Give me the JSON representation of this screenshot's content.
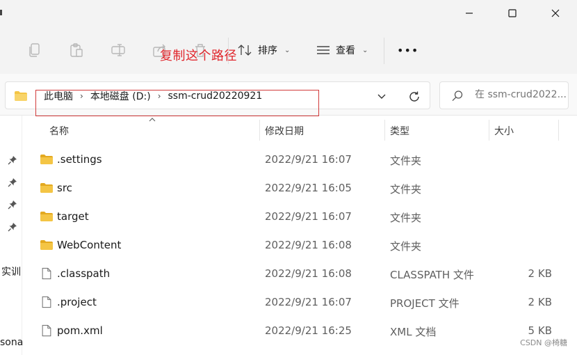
{
  "window": {
    "controls": [
      {
        "name": "minimize-button",
        "icon": "minimize-icon"
      },
      {
        "name": "maximize-button",
        "icon": "maximize-icon"
      },
      {
        "name": "close-button",
        "icon": "close-icon"
      }
    ]
  },
  "toolbar": {
    "icons": [
      "copy-icon",
      "paste-icon",
      "rename-icon",
      "share-icon",
      "delete-icon"
    ],
    "sort_label": "排序",
    "view_label": "查看",
    "more_label": "•••"
  },
  "annotation": {
    "text": "复制这个路径",
    "color": "#e0262c"
  },
  "address": {
    "crumbs": [
      "此电脑",
      "本地磁盘 (D:)",
      "ssm-crud20220921"
    ],
    "separator": "›"
  },
  "search": {
    "placeholder": "在 ssm-crud2022..."
  },
  "nav": {
    "items": [
      "实训",
      "sona"
    ]
  },
  "columns": {
    "name": "名称",
    "modified": "修改日期",
    "type": "类型",
    "size": "大小"
  },
  "files": [
    {
      "name": ".settings",
      "modified": "2022/9/21 16:07",
      "type": "文件夹",
      "size": "",
      "kind": "folder"
    },
    {
      "name": "src",
      "modified": "2022/9/21 16:05",
      "type": "文件夹",
      "size": "",
      "kind": "folder"
    },
    {
      "name": "target",
      "modified": "2022/9/21 16:07",
      "type": "文件夹",
      "size": "",
      "kind": "folder"
    },
    {
      "name": "WebContent",
      "modified": "2022/9/21 16:08",
      "type": "文件夹",
      "size": "",
      "kind": "folder"
    },
    {
      "name": ".classpath",
      "modified": "2022/9/21 16:08",
      "type": "CLASSPATH 文件",
      "size": "2 KB",
      "kind": "file"
    },
    {
      "name": ".project",
      "modified": "2022/9/21 16:07",
      "type": "PROJECT 文件",
      "size": "2 KB",
      "kind": "file"
    },
    {
      "name": "pom.xml",
      "modified": "2022/9/21 16:25",
      "type": "XML 文档",
      "size": "5 KB",
      "kind": "file"
    }
  ],
  "watermark": "CSDN @椅糖",
  "colors": {
    "folder": "#f4c545",
    "folder_dark": "#e3a920",
    "highlight": "#d23a3a"
  }
}
